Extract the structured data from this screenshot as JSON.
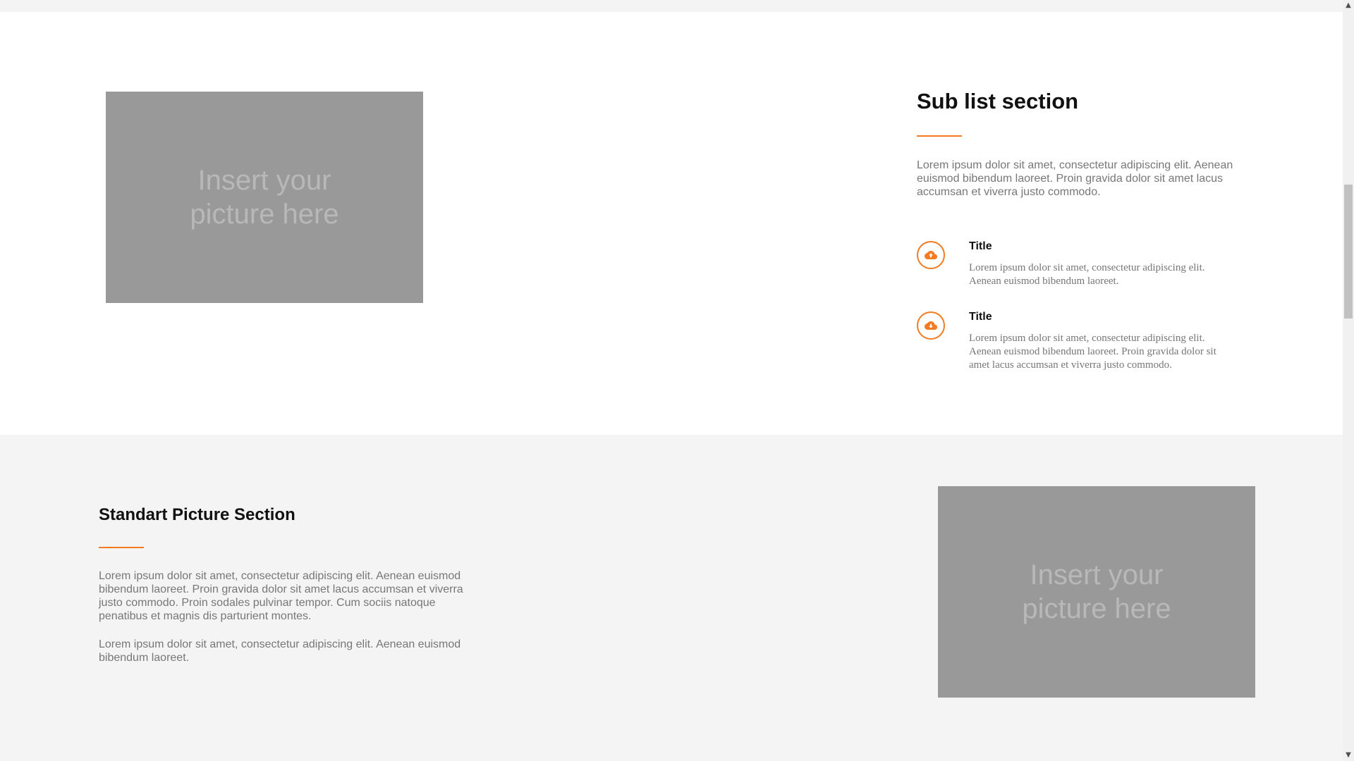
{
  "placeholder_text": "Insert your picture here",
  "sub_list_section": {
    "title": "Sub list section",
    "intro": "Lorem ipsum dolor sit amet, consectetur adipiscing elit. Aenean\neuismod bibendum laoreet. Proin gravida dolor sit amet lacus\naccumsan et viverra justo commodo.",
    "items": [
      {
        "icon": "cloud-upload-icon",
        "title": "Title",
        "text": "Lorem ipsum dolor sit amet, consectetur adipiscing elit. Aenean euismod bibendum laoreet."
      },
      {
        "icon": "cloud-download-icon",
        "title": "Title",
        "text": "Lorem ipsum dolor sit amet, consectetur adipiscing elit. Aenean euismod bibendum laoreet. Proin gravida dolor sit amet lacus accumsan et viverra justo commodo."
      }
    ]
  },
  "standard_picture_section": {
    "title": "Standart Picture Section",
    "paragraphs": [
      "Lorem ipsum dolor sit amet, consectetur adipiscing elit. Aenean euismod bibendum laoreet. Proin gravida dolor sit amet lacus accumsan et viverra justo commodo. Proin sodales pulvinar tempor. Cum sociis natoque penatibus et magnis dis parturient montes.",
      "Lorem ipsum dolor sit amet, consectetur adipiscing elit. Aenean euismod bibendum laoreet."
    ]
  },
  "colors": {
    "accent": "#f47b20",
    "placeholder_bg": "#999999",
    "placeholder_text": "#b8b8b8",
    "section_alt_bg": "#f4f4f4"
  },
  "scrollbar": {
    "up_icon": "scroll-up-arrow-icon",
    "down_icon": "scroll-down-arrow-icon"
  }
}
